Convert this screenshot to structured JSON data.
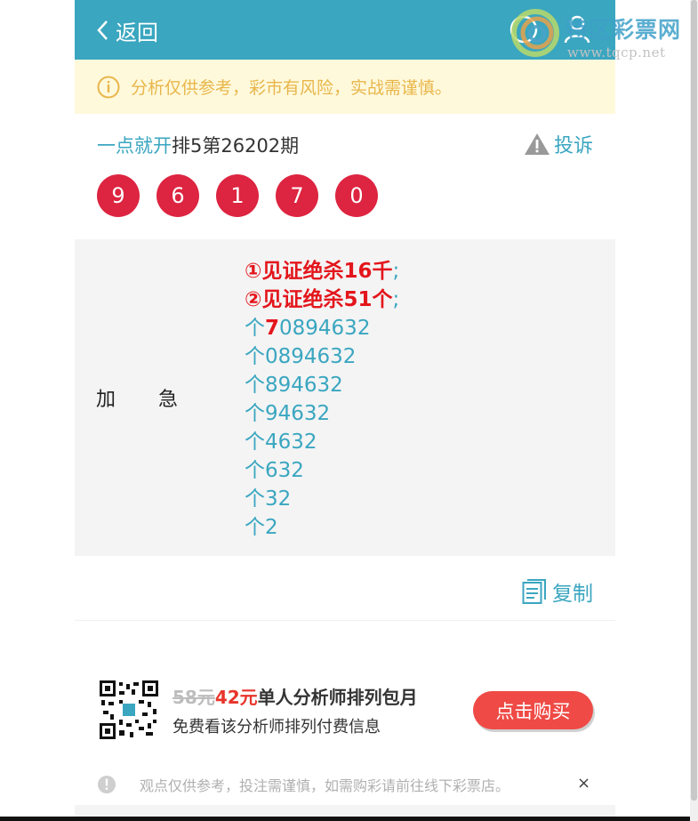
{
  "header": {
    "back_label": "返回"
  },
  "watermark": {
    "name": "特区彩票网",
    "url": "www.tqcp.net"
  },
  "notice": {
    "text": "分析仅供参考，彩市有风险，实战需谨慎。"
  },
  "issue": {
    "link": "一点就开",
    "rest": "排5第26202期",
    "complain_label": "投诉"
  },
  "balls": [
    "9",
    "6",
    "1",
    "7",
    "0"
  ],
  "content": {
    "tag_a": "加",
    "tag_b": "急",
    "line1_red": "①见证绝杀16千",
    "line1_tail": ";",
    "line2_red": "②见证绝杀51个",
    "line2_tail": ";",
    "line3_a": "个",
    "line3_red": "7",
    "line3_b": "0894632",
    "line4": "个0894632",
    "line5": "个894632",
    "line6": "个94632",
    "line7": "个4632",
    "line8": "个632",
    "line9": "个32",
    "line10": "个2"
  },
  "copy_label": "复制",
  "promo": {
    "old_price": "58元",
    "new_price": "42元",
    "title": "单人分析师排列包月",
    "subtitle": "免费看该分析师排列付费信息",
    "buy_label": "点击购买"
  },
  "disclaimer": {
    "text": "观点仅供参考，投注需谨慎，如需购彩请前往线下彩票店。",
    "close": "×"
  },
  "colors": {
    "header": "#3aa6c0",
    "ball": "#dd2440",
    "notice_bg": "#fff9dc",
    "notice_text": "#e8b64a",
    "buy": "#ef4a45"
  }
}
